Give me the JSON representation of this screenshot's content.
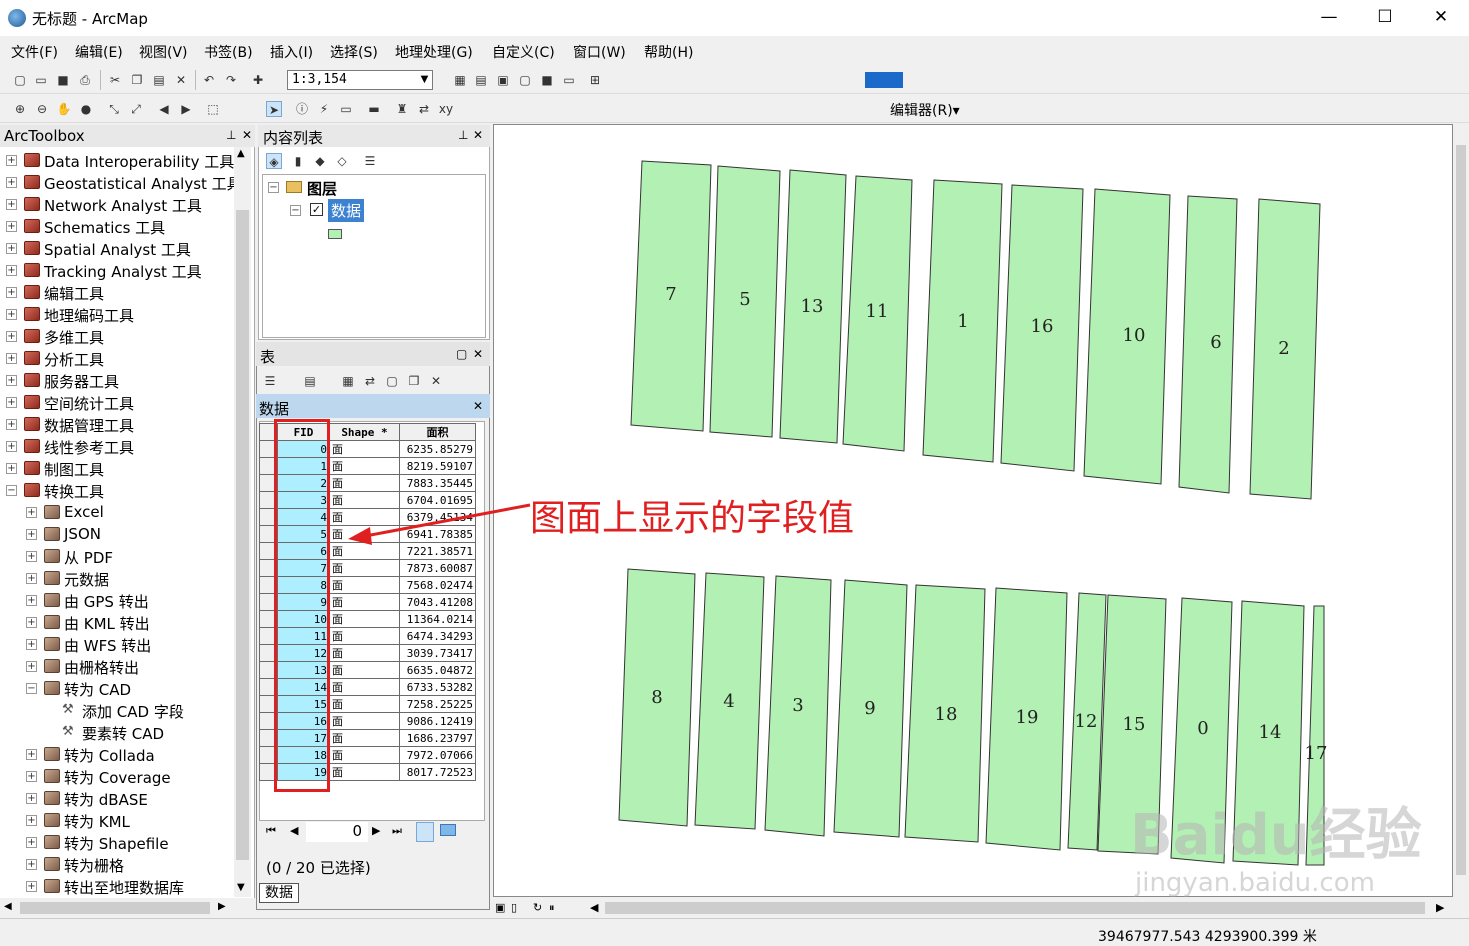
{
  "window": {
    "title": "无标题 - ArcMap",
    "minimize": "—",
    "maximize": "☐",
    "close": "✕"
  },
  "menu": [
    "文件(F)",
    "编辑(E)",
    "视图(V)",
    "书签(B)",
    "插入(I)",
    "选择(S)",
    "地理处理(G)",
    "自定义(C)",
    "窗口(W)",
    "帮助(H)"
  ],
  "toolbar": {
    "scale": "1:3,154",
    "editor_label": "编辑器(R)▾"
  },
  "toolbox": {
    "title": "ArcToolbox",
    "items": [
      {
        "label": "Data Interoperability 工具",
        "level": 0,
        "expanded": false
      },
      {
        "label": "Geostatistical Analyst 工具",
        "level": 0,
        "expanded": false
      },
      {
        "label": "Network Analyst 工具",
        "level": 0,
        "expanded": false
      },
      {
        "label": "Schematics 工具",
        "level": 0,
        "expanded": false
      },
      {
        "label": "Spatial Analyst 工具",
        "level": 0,
        "expanded": false
      },
      {
        "label": "Tracking Analyst 工具",
        "level": 0,
        "expanded": false
      },
      {
        "label": "编辑工具",
        "level": 0,
        "expanded": false
      },
      {
        "label": "地理编码工具",
        "level": 0,
        "expanded": false
      },
      {
        "label": "多维工具",
        "level": 0,
        "expanded": false
      },
      {
        "label": "分析工具",
        "level": 0,
        "expanded": false
      },
      {
        "label": "服务器工具",
        "level": 0,
        "expanded": false
      },
      {
        "label": "空间统计工具",
        "level": 0,
        "expanded": false
      },
      {
        "label": "数据管理工具",
        "level": 0,
        "expanded": false
      },
      {
        "label": "线性参考工具",
        "level": 0,
        "expanded": false
      },
      {
        "label": "制图工具",
        "level": 0,
        "expanded": false
      },
      {
        "label": "转换工具",
        "level": 0,
        "expanded": true
      },
      {
        "label": "Excel",
        "level": 1,
        "expanded": false
      },
      {
        "label": "JSON",
        "level": 1,
        "expanded": false
      },
      {
        "label": "从 PDF",
        "level": 1,
        "expanded": false
      },
      {
        "label": "元数据",
        "level": 1,
        "expanded": false
      },
      {
        "label": "由 GPS 转出",
        "level": 1,
        "expanded": false
      },
      {
        "label": "由 KML 转出",
        "level": 1,
        "expanded": false
      },
      {
        "label": "由 WFS 转出",
        "level": 1,
        "expanded": false
      },
      {
        "label": "由栅格转出",
        "level": 1,
        "expanded": false
      },
      {
        "label": "转为 CAD",
        "level": 1,
        "expanded": true
      },
      {
        "label": "添加 CAD 字段",
        "level": 2,
        "expanded": false
      },
      {
        "label": "要素转 CAD",
        "level": 2,
        "expanded": false
      },
      {
        "label": "转为 Collada",
        "level": 1,
        "expanded": false
      },
      {
        "label": "转为 Coverage",
        "level": 1,
        "expanded": false
      },
      {
        "label": "转为 dBASE",
        "level": 1,
        "expanded": false
      },
      {
        "label": "转为 KML",
        "level": 1,
        "expanded": false
      },
      {
        "label": "转为 Shapefile",
        "level": 1,
        "expanded": false
      },
      {
        "label": "转为栅格",
        "level": 1,
        "expanded": false
      },
      {
        "label": "转出至地理数据库",
        "level": 1,
        "expanded": false
      }
    ]
  },
  "toc": {
    "title": "内容列表",
    "root": "图层",
    "layer": "数据"
  },
  "table": {
    "window_title": "表",
    "tab_title": "数据",
    "columns": [
      "FID",
      "Shape *",
      "面积"
    ],
    "rows": [
      [
        "0",
        "面",
        "6235.85279"
      ],
      [
        "1",
        "面",
        "8219.59107"
      ],
      [
        "2",
        "面",
        "7883.35445"
      ],
      [
        "3",
        "面",
        "6704.01695"
      ],
      [
        "4",
        "面",
        "6379.45134"
      ],
      [
        "5",
        "面",
        "6941.78385"
      ],
      [
        "6",
        "面",
        "7221.38571"
      ],
      [
        "7",
        "面",
        "7873.60087"
      ],
      [
        "8",
        "面",
        "7568.02474"
      ],
      [
        "9",
        "面",
        "7043.41208"
      ],
      [
        "10",
        "面",
        "11364.0214"
      ],
      [
        "11",
        "面",
        "6474.34293"
      ],
      [
        "12",
        "面",
        "3039.73417"
      ],
      [
        "13",
        "面",
        "6635.04872"
      ],
      [
        "14",
        "面",
        "6733.53282"
      ],
      [
        "15",
        "面",
        "7258.25225"
      ],
      [
        "16",
        "面",
        "9086.12419"
      ],
      [
        "17",
        "面",
        "1686.23797"
      ],
      [
        "18",
        "面",
        "7972.07066"
      ],
      [
        "19",
        "面",
        "8017.72523"
      ]
    ],
    "record_index": "0",
    "selection_status": "(0 / 20 已选择)",
    "bottom_tab": "数据"
  },
  "map": {
    "parcel_labels": [
      "7",
      "5",
      "13",
      "11",
      "1",
      "16",
      "10",
      "6",
      "2",
      "8",
      "4",
      "3",
      "9",
      "18",
      "19",
      "12",
      "15",
      "0",
      "14",
      "17"
    ],
    "fill_color": "#b3f0b3",
    "annotation": "图面上显示的字段值",
    "annotation_color": "#e02020"
  },
  "status": {
    "coords": "39467977.543  4293900.399 米"
  },
  "watermark": {
    "main": "Baidu经验",
    "sub": "jingyan.baidu.com"
  }
}
